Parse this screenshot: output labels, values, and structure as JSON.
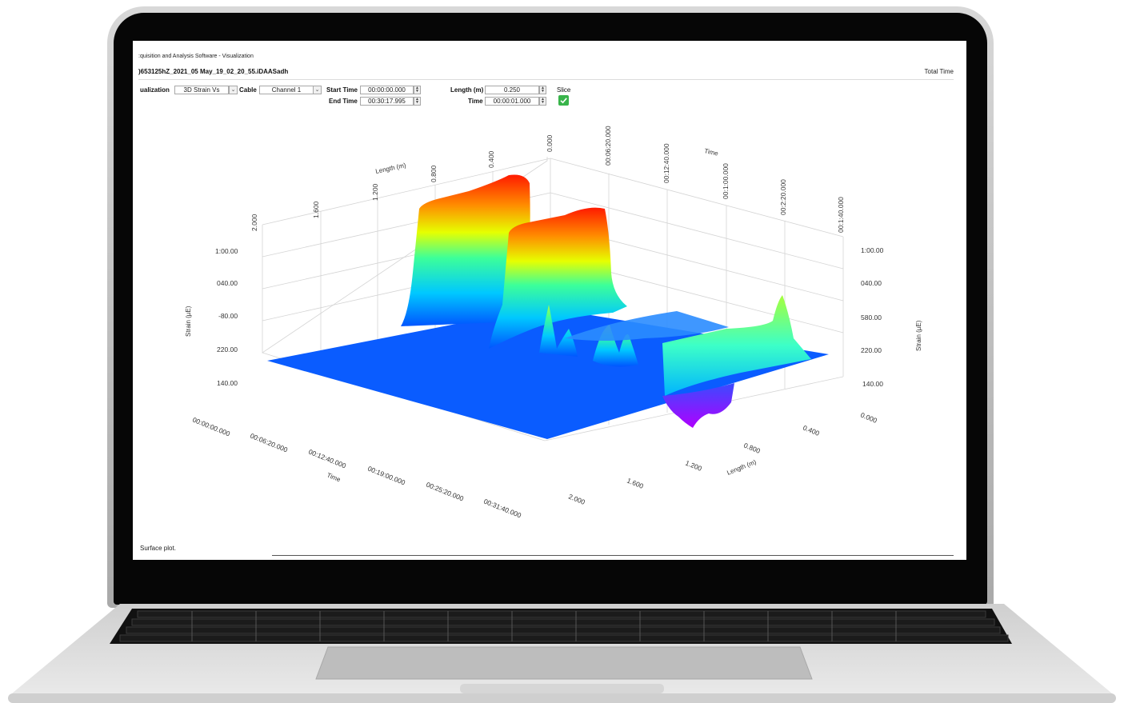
{
  "window": {
    "title": ":quisition and Analysis Software - Visualization",
    "file": ")653125hZ_2021_05 May_19_02_20_55.iDAASadh",
    "total_time_label": "Total Time"
  },
  "controls": {
    "visualization_label": "ualization",
    "visualization_value": "3D Strain Vs",
    "cable_label": "Cable",
    "cable_value": "Channel 1",
    "start_time_label": "Start Time",
    "start_time_value": "00:00:00.000",
    "end_time_label": "End Time",
    "end_time_value": "00:30:17.995",
    "length_label": "Length (m)",
    "length_value": "0.250",
    "time_label": "Time",
    "time_value": "00:00:01.000",
    "slice_label": "Slice",
    "slice_checked": true
  },
  "plot": {
    "left_axis_title": "Strain (µE)",
    "right_axis_title": "Strain (µE)",
    "left_strain_ticks": [
      "1:00.00",
      "040.00",
      "-80.00",
      "220.00",
      "140.00"
    ],
    "right_strain_ticks": [
      "1:00.00",
      "040.00",
      "580.00",
      "220.00",
      "140.00"
    ],
    "back_length_title": "Length (m)",
    "back_length_ticks": [
      "2.000",
      "1.600",
      "1.200",
      "0.800",
      "0.400",
      "0.000"
    ],
    "back_time_title": "Time",
    "back_time_ticks": [
      "00:06:20.000",
      "00:12:40.000",
      "00:1:00.000",
      "00:2:20.000",
      "00:1:40.000"
    ],
    "front_time_title": "Time",
    "front_time_ticks": [
      "00:00:00.000",
      "00:06:20.000",
      "00:12:40.000",
      "00:19:00.000",
      "00:25:20.000",
      "00:31:40.000"
    ],
    "front_length_title": "Length (m)",
    "front_length_ticks": [
      "0.000",
      "0.400",
      "0.800",
      "1.200",
      "1.600",
      "2.000"
    ],
    "colorscale": [
      "#0055ff",
      "#00c8ff",
      "#3cff9a",
      "#e6ff00",
      "#ff8c00",
      "#ff1a00"
    ]
  },
  "status": {
    "text": "Surface plot."
  }
}
